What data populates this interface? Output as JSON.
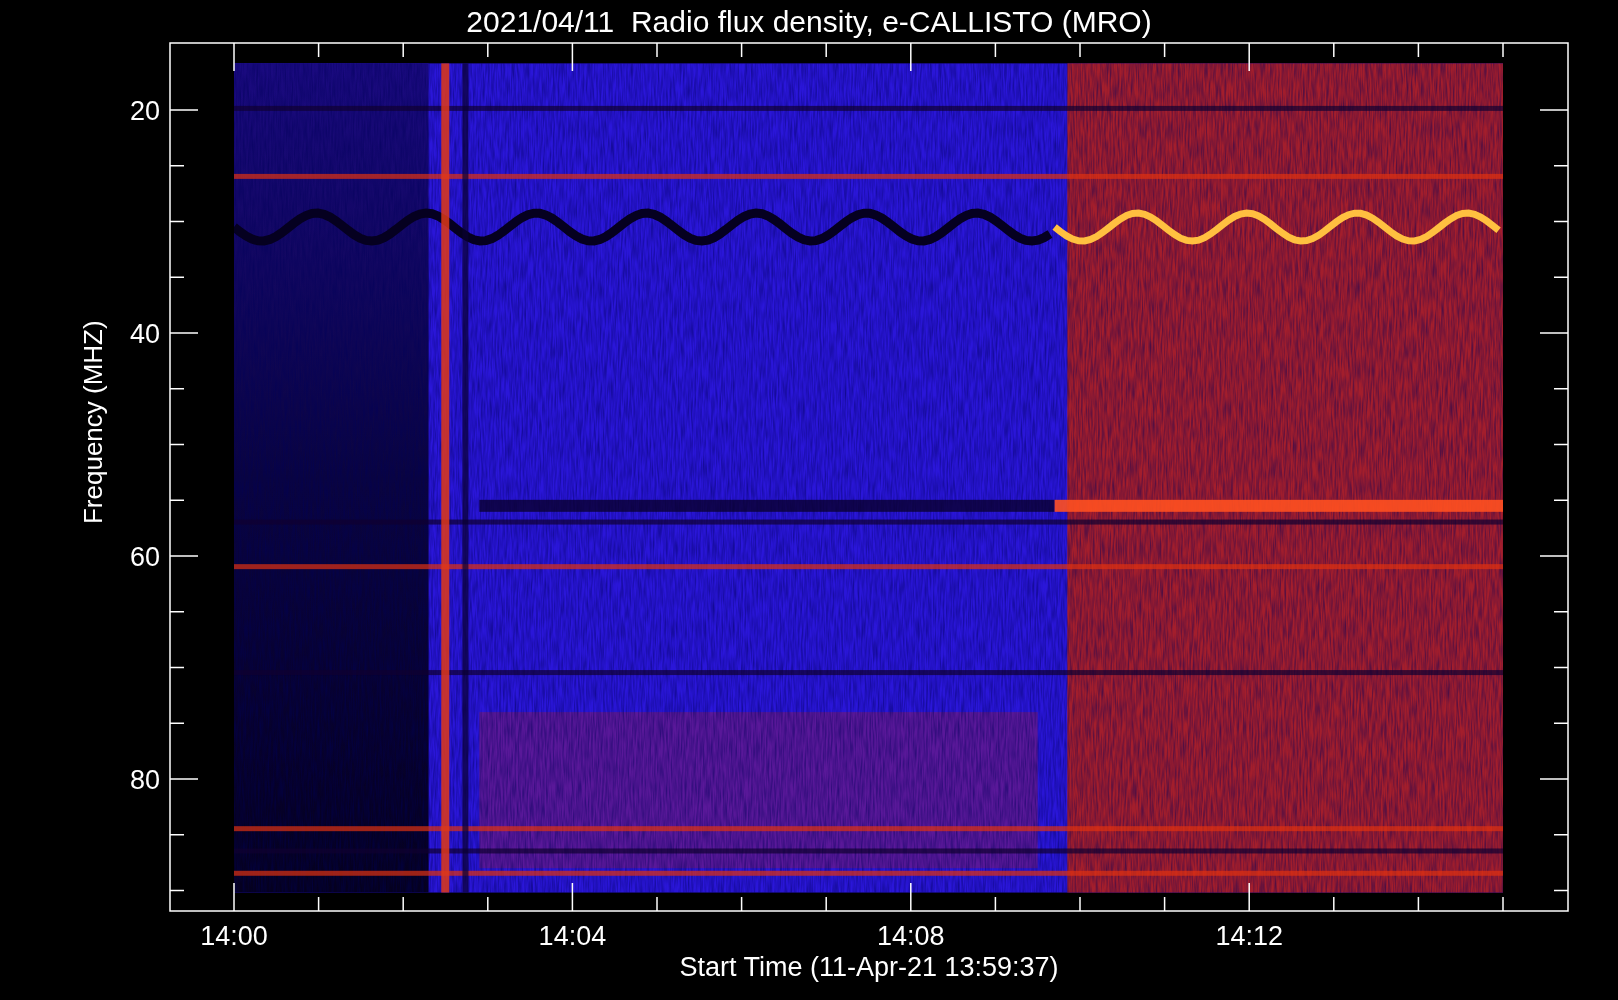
{
  "title": "2021/04/11  Radio flux density, e-CALLISTO (MRO)",
  "y_axis": {
    "label": "Frequency (MHZ)",
    "ticks": [
      "20",
      "40",
      "60",
      "80"
    ]
  },
  "x_axis": {
    "label": "Start Time (11-Apr-21 13:59:37)",
    "ticks": [
      "14:00",
      "14:04",
      "14:08",
      "14:12"
    ]
  }
}
